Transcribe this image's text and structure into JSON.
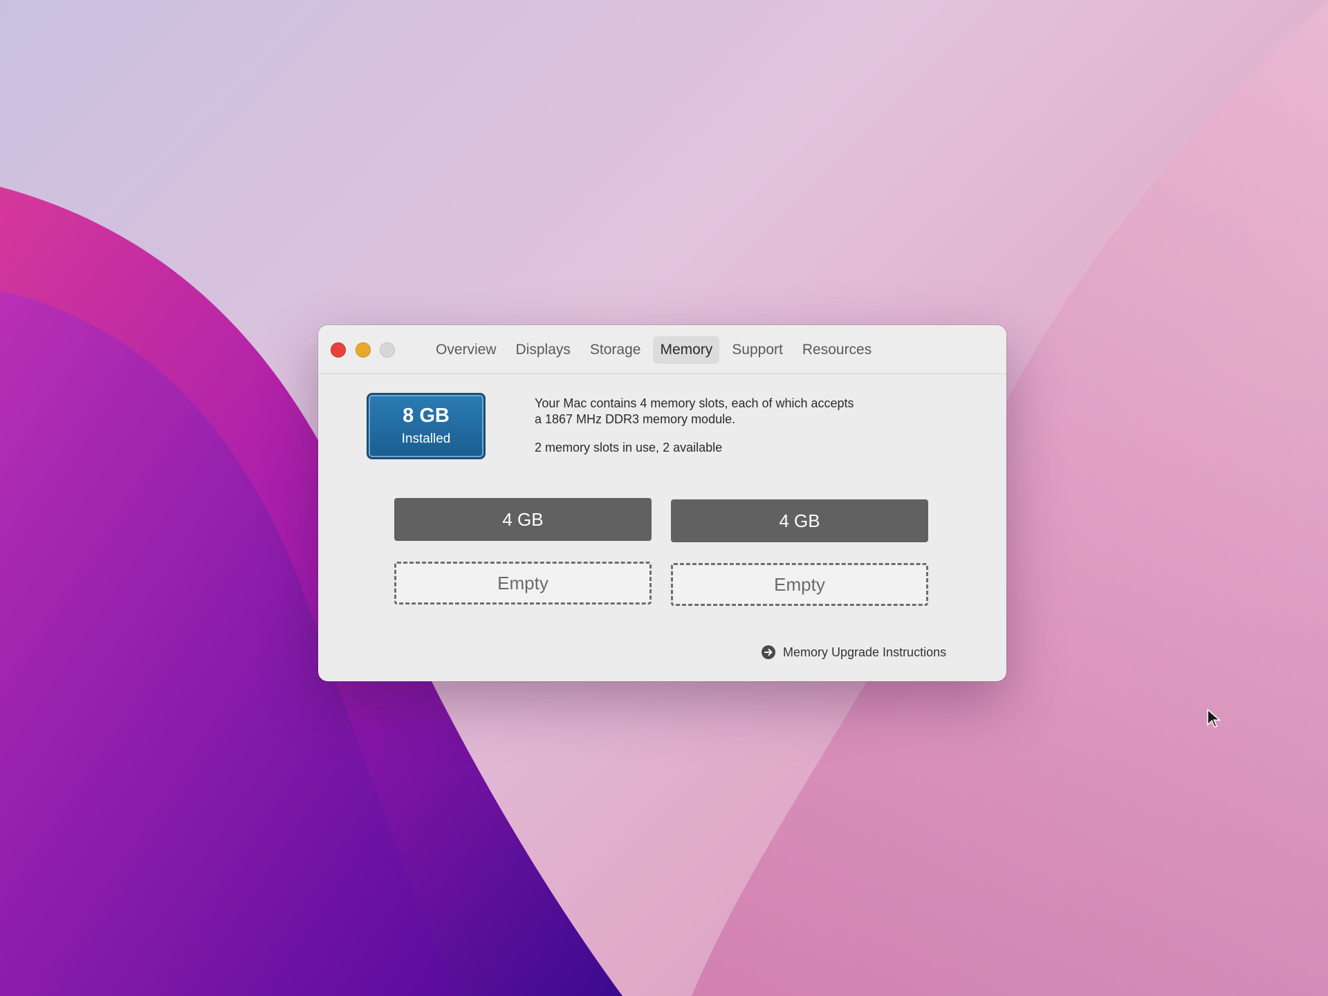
{
  "window": {
    "tabs": [
      {
        "label": "Overview"
      },
      {
        "label": "Displays"
      },
      {
        "label": "Storage"
      },
      {
        "label": "Memory",
        "selected": true
      },
      {
        "label": "Support"
      },
      {
        "label": "Resources"
      }
    ]
  },
  "memory": {
    "installed_size": "8 GB",
    "installed_label": "Installed",
    "description_line1": "Your Mac contains 4 memory slots, each of which accepts",
    "description_line2": "a 1867 MHz DDR3 memory module.",
    "usage": "2 memory slots in use, 2 available",
    "slots": [
      {
        "label": "4 GB",
        "state": "filled"
      },
      {
        "label": "4 GB",
        "state": "filled"
      },
      {
        "label": "Empty",
        "state": "empty"
      },
      {
        "label": "Empty",
        "state": "empty"
      }
    ],
    "upgrade_link": "Memory Upgrade Instructions"
  },
  "colors": {
    "installed_badge": "#1f6ea3",
    "filled_slot": "#616161",
    "close_button": "#e9403c",
    "minimize_button": "#e8a92a",
    "zoom_button": "#d7d7d7"
  },
  "icons": {
    "close": "close-icon",
    "minimize": "minimize-icon",
    "zoom": "zoom-icon",
    "upgrade": "arrow-right-circle-icon",
    "cursor": "mouse-pointer-icon"
  }
}
